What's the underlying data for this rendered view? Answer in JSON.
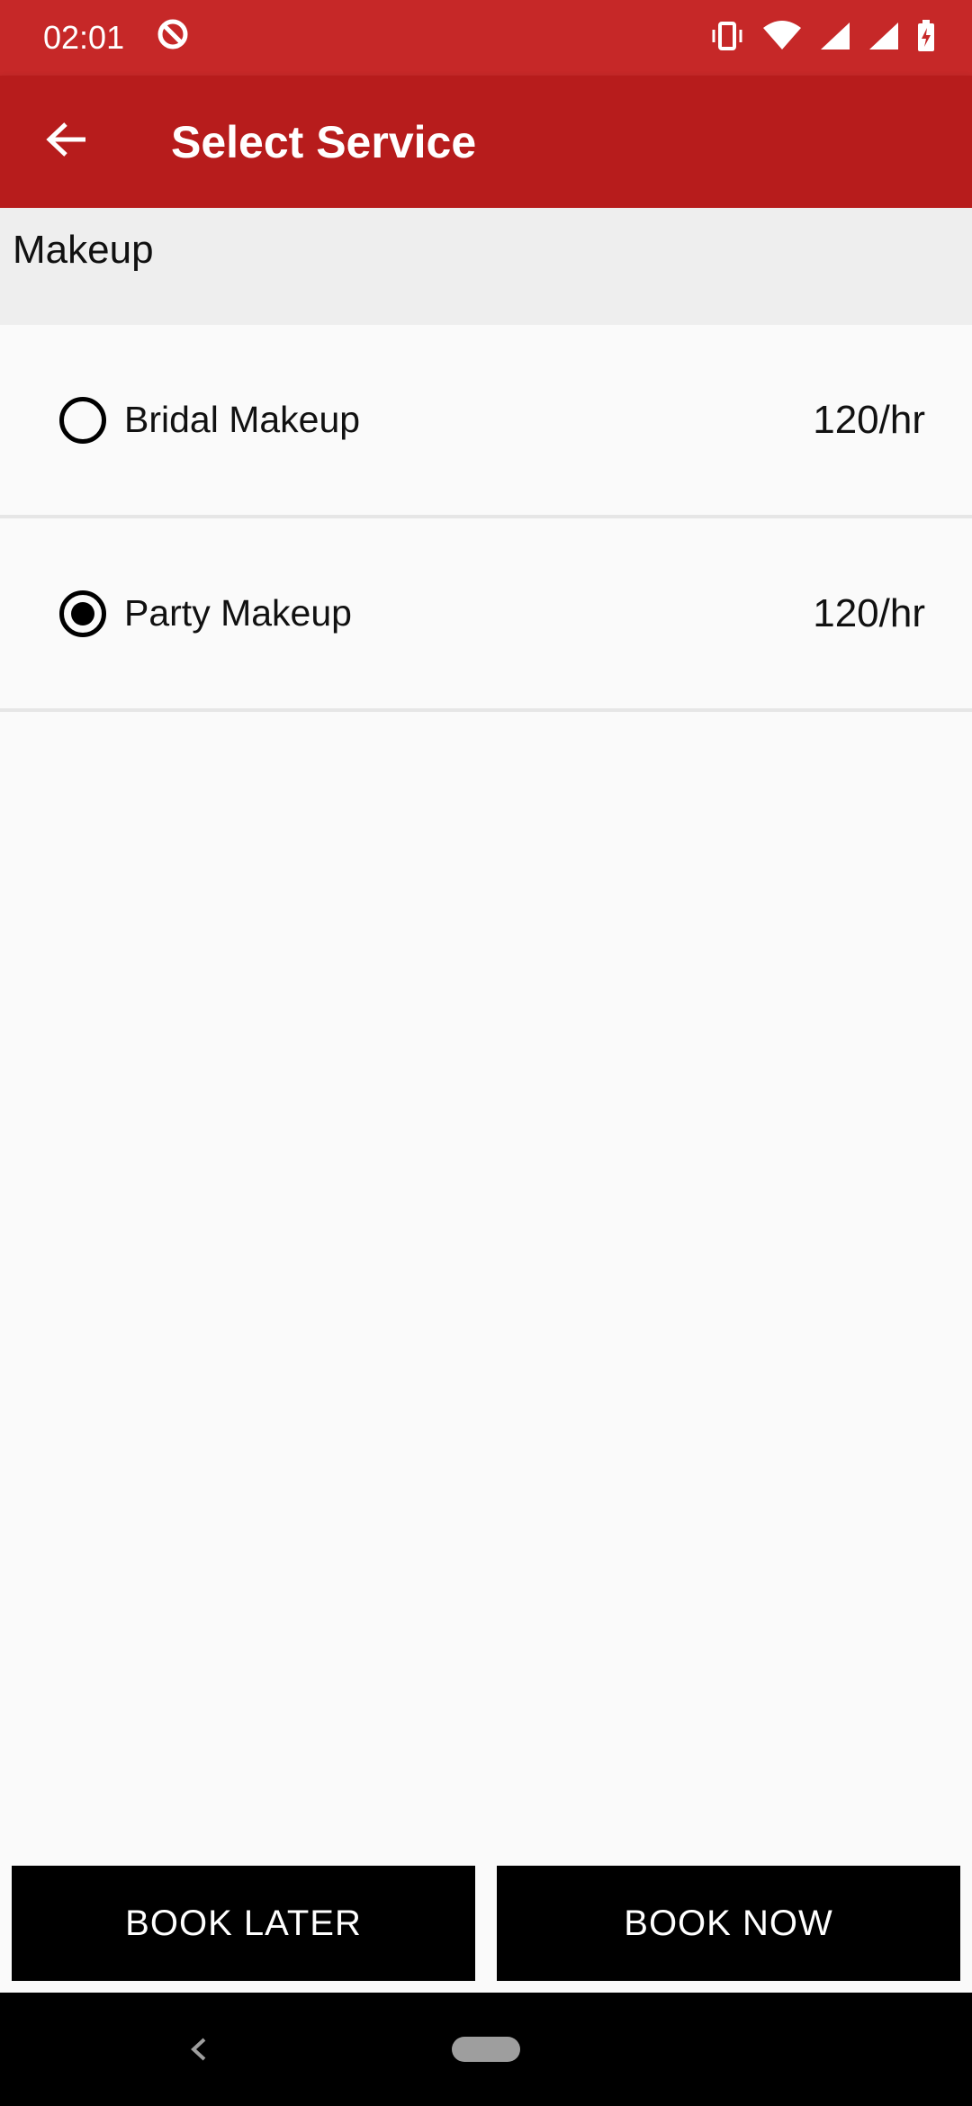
{
  "status_bar": {
    "time": "02:01"
  },
  "app_bar": {
    "title": "Select Service"
  },
  "section": {
    "title": "Makeup"
  },
  "services": [
    {
      "name": "Bridal Makeup",
      "price": "120/hr",
      "selected": false
    },
    {
      "name": "Party Makeup",
      "price": "120/hr",
      "selected": true
    }
  ],
  "buttons": {
    "book_later": "BOOK LATER",
    "book_now": "BOOK NOW"
  },
  "colors": {
    "status_bar": "#c62828",
    "app_bar": "#b71c1c",
    "button": "#000000"
  }
}
